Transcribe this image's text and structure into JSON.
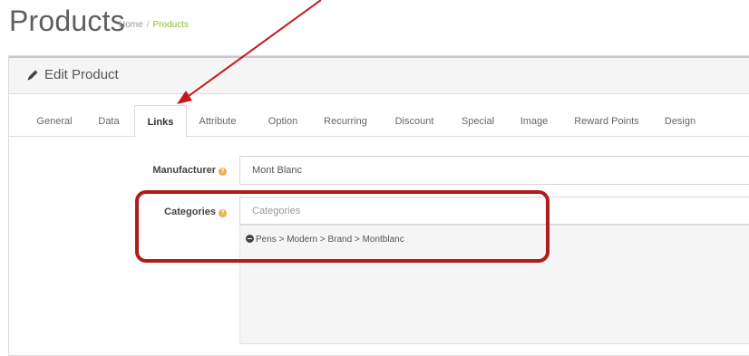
{
  "header": {
    "title": "Products",
    "breadcrumb": {
      "home": "Home",
      "separator": "/",
      "current": "Products"
    }
  },
  "panel": {
    "title": "Edit Product",
    "icon": "pencil-icon"
  },
  "tabs": [
    {
      "label": "General"
    },
    {
      "label": "Data"
    },
    {
      "label": "Links",
      "active": true
    },
    {
      "label": "Attribute"
    },
    {
      "label": "Option"
    },
    {
      "label": "Recurring"
    },
    {
      "label": "Discount"
    },
    {
      "label": "Special"
    },
    {
      "label": "Image"
    },
    {
      "label": "Reward Points"
    },
    {
      "label": "Design"
    }
  ],
  "form": {
    "manufacturer": {
      "label": "Manufacturer",
      "value": "Mont Blanc"
    },
    "categories": {
      "label": "Categories",
      "placeholder": "Categories",
      "selected": [
        "Pens > Modern > Brand > Montblanc"
      ]
    },
    "help_glyph": "?"
  },
  "annotation_colors": {
    "arrow": "#c8161d",
    "highlight": "#b01c1c"
  }
}
